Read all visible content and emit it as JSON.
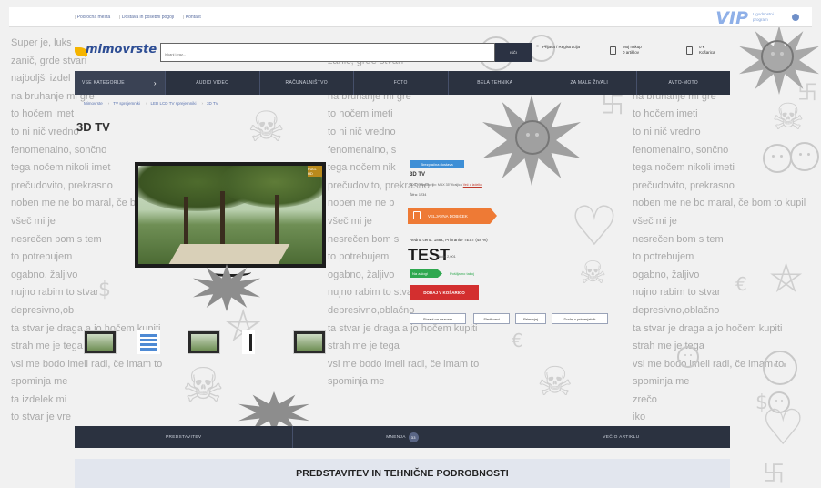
{
  "background_text": {
    "left": [
      "Super je, luks",
      "zanič, grde stvari",
      "najboljši izdel",
      "na bruhanje mi gre",
      "to hočem imet",
      "to ni nič vredno",
      "fenomenalno, sončno",
      "tega nočem nikoli imet",
      "prečudovito, prekrasno",
      "noben me ne bo maral, če b",
      "všeč mi je",
      "nesrečen bom s tem",
      "to potrebujem",
      "ogabno, žaljivo",
      "nujno rabim to stvar",
      "depresivno,ob",
      "ta stvar je draga a jo hočem kupiti",
      "strah me je tega",
      "vsi me bodo imeli radi, če imam to",
      "spominja me",
      "ta izdelek mi",
      "to stvar je vre"
    ],
    "middle": [
      "",
      "zanič, grde stvari",
      "",
      "na bruhanje mi gre",
      "to hočem imeti",
      "to ni nič vredno",
      "fenomenalno, s",
      "tega nočem nik",
      "prečudovito, prekrasno",
      "noben me ne b",
      "všeč mi je",
      "nesrečen bom s",
      "to potrebujem",
      "ogabno, žaljivo",
      "nujno rabim to stvar",
      "depresivno,oblačno",
      "ta stvar je draga a jo hočem kupiti",
      "strah me je tega",
      "vsi me bodo imeli radi, če imam to",
      "spominja me",
      "",
      ""
    ],
    "right": [
      "",
      "",
      "",
      "na bruhanje mi gre",
      "to hočem imeti",
      "to ni nič vredno",
      "fenomenalno, sončno",
      "tega nočem nikoli imeti",
      "prečudovito, prekrasno",
      "noben me ne bo maral, če bom to kupil",
      "všeč mi je",
      "nesrečen bom s tem",
      "to potrebujem",
      "ogabno, žaljivo",
      "nujno rabim to stvar",
      "depresivno,oblačno",
      "ta stvar je draga a jo hočem kupiti",
      "strah me je tega",
      "vsi me bodo imeli radi, če imam to",
      "spominja me",
      "zrečo",
      "iko"
    ]
  },
  "topbar": {
    "links": [
      "Področna mesta",
      "Dostava in posebni pogoji",
      "Kontakt"
    ],
    "vip_label": "VIP",
    "vip_sub": "Ugodnostni program"
  },
  "header": {
    "logo": "mimovrste",
    "search_placeholder": "Iskani izraz...",
    "search_button": "IŠČI",
    "login_text": "Prijava / Registracija",
    "cart_text": "Moj nakup",
    "cart_sub": "0 artiklov",
    "compare_text": "0 €",
    "compare_sub": "Košarica"
  },
  "nav": [
    "VSE KATEGORIJE",
    "AUDIO VIDEO",
    "RAČUNALNIŠTVO",
    "FOTO",
    "BELA TEHNIKA",
    "ZA MALE ŽIVALI",
    "AVTO-MOTO"
  ],
  "breadcrumb": [
    "Mimovrste",
    "TV sprejemniki",
    "LED LCD TV sprejemniki",
    "3D TV"
  ],
  "page_title": "3D TV",
  "product": {
    "hd_badge": "FULL HD",
    "badge": "Brezplačna dostava",
    "name": "3D TV",
    "desc": "3D TV razpoložljiv: MAX 35\" Kraljica",
    "desc_link": "Več o izdelku",
    "code": "Šifra: 1234",
    "orange_cta": "VELJAVNA DOBIČEK",
    "price_regular": "Redna cena: 188€, Prihranite TEST (48 %)",
    "price": "TEST",
    "price_note": "Akcija 2,001",
    "stock": "Na zalogi",
    "stock_note": "Pošiljamo takoj",
    "cart_button": "DODAJ V KOŠARICO",
    "small_buttons": [
      "Shrani na seznam",
      "Sledi ceni",
      "Primerjaj",
      "Dodaj v primerjalnik"
    ]
  },
  "tabs": {
    "items": [
      "PREDSTAVITEV",
      "MNENJA",
      "VEČ O ARTIKLU"
    ],
    "reviews_count": "33"
  },
  "section_heading": "PREDSTAVITEV IN TEHNIČNE PODROBNOSTI",
  "colors": {
    "nav_bg": "#2b3240",
    "cart_red": "#d32f2f",
    "cta_orange": "#ee7a35",
    "stock_green": "#2fa84f",
    "badge_blue": "#3e8fd6",
    "logo_blue": "#2d4d94"
  }
}
